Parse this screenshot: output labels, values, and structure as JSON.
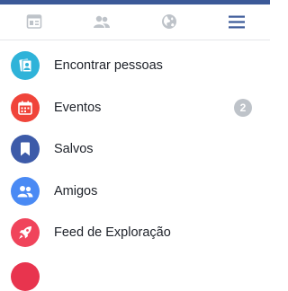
{
  "colors": {
    "brand": "#3b5998",
    "tab_inactive": "#bec3c9",
    "menu_active": "#3b5998"
  },
  "tabs": [
    {
      "icon": "news-feed-icon",
      "active": false
    },
    {
      "icon": "friends-icon",
      "active": false
    },
    {
      "icon": "globe-icon",
      "active": false
    },
    {
      "icon": "hamburger-menu-icon",
      "active": true
    }
  ],
  "menu": {
    "items": [
      {
        "label": "Encontrar pessoas",
        "icon": "find-people-icon",
        "color": "#2fb3d9"
      },
      {
        "label": "Eventos",
        "icon": "calendar-icon",
        "color": "#f0443a",
        "badge": "2"
      },
      {
        "label": "Salvos",
        "icon": "bookmark-icon",
        "color": "#3d5ba9"
      },
      {
        "label": "Amigos",
        "icon": "friends-icon",
        "color": "#4a8af4"
      },
      {
        "label": "Feed de Exploração",
        "icon": "rocket-icon",
        "color": "#f0445b"
      }
    ],
    "partial_item_color": "#e8344e"
  }
}
